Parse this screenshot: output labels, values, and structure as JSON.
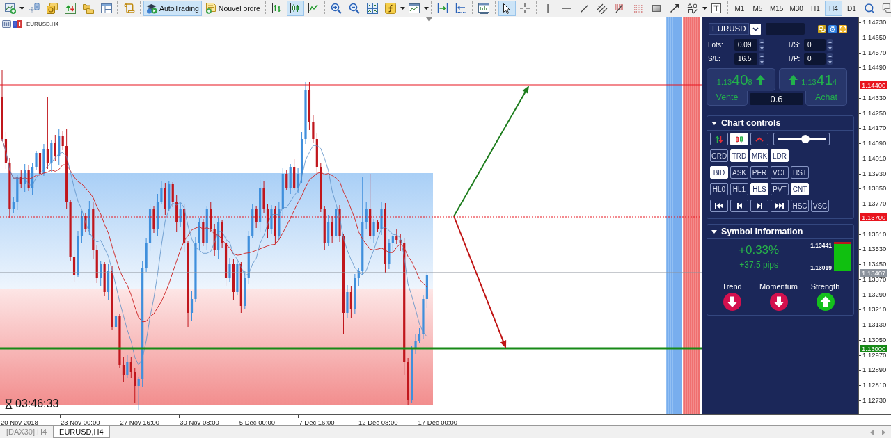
{
  "toolbar": {
    "autotrading": {
      "label": "AutoTrading",
      "on": true
    },
    "new_order": {
      "label": "Nouvel ordre"
    },
    "chart_types": [
      {
        "kind": "bars",
        "selected": false
      },
      {
        "kind": "candles",
        "selected": true
      },
      {
        "kind": "line",
        "selected": false
      }
    ],
    "tools": [
      {
        "kind": "cursor",
        "selected": true
      },
      {
        "kind": "crosshair",
        "selected": false
      }
    ],
    "timeframes": [
      {
        "label": "M1",
        "selected": false
      },
      {
        "label": "M5",
        "selected": false
      },
      {
        "label": "M15",
        "selected": false
      },
      {
        "label": "M30",
        "selected": false
      },
      {
        "label": "H1",
        "selected": false
      },
      {
        "label": "H4",
        "selected": true
      },
      {
        "label": "D1",
        "selected": false
      }
    ]
  },
  "chart": {
    "title": "EURUSD,H4",
    "timer": "03:46:33",
    "price_ticks": [
      "1.14730",
      "1.14650",
      "1.14570",
      "1.14490",
      "1.14330",
      "1.14250",
      "1.14170",
      "1.14090",
      "1.14010",
      "1.13930",
      "1.13850",
      "1.13770",
      "1.13610",
      "1.13530",
      "1.13450",
      "1.13370",
      "1.13290",
      "1.13210",
      "1.13130",
      "1.13050",
      "1.12970",
      "1.12890",
      "1.12810",
      "1.12730"
    ],
    "price_markers": [
      {
        "label": "1.14400",
        "color": "#e8141e",
        "kind": "solid"
      },
      {
        "label": "1.13700",
        "color": "#e8141e",
        "kind": "dotted"
      },
      {
        "label": "1.13407",
        "color": "#8c939c",
        "kind": "thin"
      },
      {
        "label": "1.13000",
        "color": "#178a17",
        "kind": "thick"
      }
    ],
    "time_labels": [
      "20 Nov 2018",
      "23 Nov 00:00",
      "27 Nov 16:00",
      "30 Nov 08:00",
      "5 Dec 00:00",
      "7 Dec 16:00",
      "12 Dec 08:00",
      "17 Dec 00:00"
    ]
  },
  "trade_panel": {
    "symbol": "EURUSD",
    "fields": [
      {
        "label": "Lots:",
        "value": "0.09"
      },
      {
        "label": "T/S:",
        "value": "0"
      },
      {
        "label": "S/L:",
        "value": "16.5"
      },
      {
        "label": "T/P:",
        "value": "0"
      }
    ],
    "sell": {
      "price_head": "1.13",
      "price_big": "40",
      "price_tail": "8",
      "rising": true,
      "label": "Vente"
    },
    "buy": {
      "price_head": "1.13",
      "price_big": "41",
      "price_tail": "4",
      "rising": true,
      "label": "Achat"
    },
    "spread": "0.6"
  },
  "chart_controls": {
    "title": "Chart controls",
    "expanded": true,
    "icon_buttons": [
      {
        "kind": "sort",
        "on": false
      },
      {
        "kind": "candles",
        "on": true
      },
      {
        "kind": "caret",
        "on": false
      }
    ],
    "slider": {
      "level": 0.57
    },
    "rows": [
      {
        "buttons": [
          {
            "kind": "text",
            "label": "GRD",
            "on": false
          },
          {
            "kind": "text",
            "label": "TRD",
            "on": true
          },
          {
            "kind": "text",
            "label": "MRK",
            "on": true
          },
          {
            "kind": "text",
            "label": "LDR",
            "on": true
          }
        ]
      },
      {
        "buttons": [
          {
            "kind": "text",
            "label": "BID",
            "on": true
          },
          {
            "kind": "text",
            "label": "ASK",
            "on": false
          },
          {
            "kind": "text",
            "label": "PER",
            "on": false
          },
          {
            "kind": "text",
            "label": "VOL",
            "on": false
          },
          {
            "kind": "text",
            "label": "HST",
            "on": false
          }
        ]
      },
      {
        "buttons": [
          {
            "kind": "text",
            "label": "HL0",
            "on": false
          },
          {
            "kind": "text",
            "label": "HL1",
            "on": false
          },
          {
            "kind": "text",
            "label": "HLS",
            "on": true
          },
          {
            "kind": "text",
            "label": "PVT",
            "on": false
          },
          {
            "kind": "text",
            "label": "CNT",
            "on": true
          }
        ]
      },
      {
        "buttons": [
          {
            "kind": "first",
            "on": false
          },
          {
            "kind": "prev",
            "on": false
          },
          {
            "kind": "next",
            "on": false
          },
          {
            "kind": "last",
            "on": false
          },
          {
            "kind": "text",
            "label": "HSC",
            "on": false
          },
          {
            "kind": "text",
            "label": "VSC",
            "on": false
          }
        ]
      }
    ]
  },
  "symbol_info": {
    "title": "Symbol information",
    "expanded": true,
    "change": "+0.33%",
    "pips": "+37.5 pips",
    "range": {
      "high": "1.13441",
      "low": "1.13019",
      "level": 0.92
    },
    "indicators": [
      {
        "label": "Trend",
        "rising": false
      },
      {
        "label": "Momentum",
        "rising": false
      },
      {
        "label": "Strength",
        "rising": true
      }
    ]
  },
  "chart_tabs": [
    {
      "label": "[DAX30],H4",
      "selected": false
    },
    {
      "label": "EURUSD,H4",
      "selected": true
    }
  ]
}
